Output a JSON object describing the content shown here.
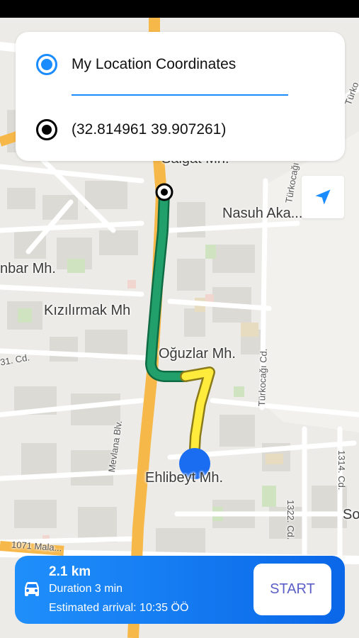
{
  "search": {
    "from_label": "My Location Coordinates",
    "to_value": "(32.814961 39.907261)"
  },
  "map": {
    "districts": [
      {
        "id": "saigat",
        "text": "Saigat Mh."
      },
      {
        "id": "nasuh",
        "text": "Nasuh Aka..."
      },
      {
        "id": "nbar",
        "text": "nbar Mh."
      },
      {
        "id": "kizilirmak",
        "text": "Kızılırmak Mh"
      },
      {
        "id": "oguzlar",
        "text": "Oğuzlar Mh."
      },
      {
        "id": "ehlibeyt",
        "text": "Ehlibeyt Mh."
      },
      {
        "id": "so",
        "text": "So"
      }
    ],
    "streets": [
      {
        "id": "mevlana",
        "text": "Mevlana Blv."
      },
      {
        "id": "turkocagi",
        "text": "Türkocağı Cd."
      },
      {
        "id": "turkocagi2",
        "text": "Türkocağı"
      },
      {
        "id": "c1322",
        "text": "1322. Cd."
      },
      {
        "id": "c1314",
        "text": "1314. Cd."
      },
      {
        "id": "c1071",
        "text": "1071 Mala..."
      },
      {
        "id": "c31",
        "text": "31. Cd."
      },
      {
        "id": "turko_top",
        "text": "Türko"
      }
    ],
    "colors": {
      "route_traveled": "#22a06b",
      "route_remaining": "#ffeb3b",
      "current_location": "#1a6cf0",
      "main_road": "#f7b84a"
    }
  },
  "route": {
    "distance": "2.1 km",
    "duration": "Duration 3 min",
    "arrival": "Estimated arrival: 10:35 ÖÖ",
    "start_label": "START"
  },
  "icons": {
    "radio_from": "radio-selected-icon",
    "radio_to": "destination-marker-icon",
    "locate": "navigation-arrow-icon",
    "vehicle": "car-icon"
  }
}
